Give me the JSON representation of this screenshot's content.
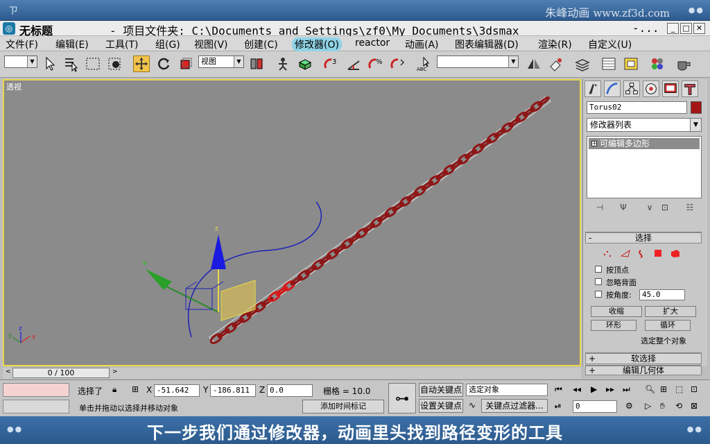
{
  "player": {
    "logo": "ㄗ",
    "watermark": "朱峰动画",
    "watermark_url": "www.zf3d.com",
    "dots_left": "●●",
    "dots_right": "●●"
  },
  "window": {
    "title": "无标题",
    "path": "- 项目文件夹: C:\\Documents and Settings\\zf0\\My Documents\\3dsmax",
    "ellipsis": "-...",
    "min": "_",
    "max": "□",
    "close": "✕"
  },
  "menu": [
    "文件(F)",
    "编辑(E)",
    "工具(T)",
    "组(G)",
    "视图(V)",
    "创建(C)",
    "修改器(O)",
    "reactor",
    "动画(A)",
    "图表编辑器(D)",
    "渲染(R)",
    "自定义(U)"
  ],
  "toolbar": {
    "view_dropdown": "视图",
    "named_selection": ""
  },
  "viewport": {
    "label": "透视",
    "axis_x": "x",
    "axis_y": "y",
    "axis_z": "z",
    "gizmo_y": "y",
    "gizmo_z": "z"
  },
  "command_panel": {
    "object_name": "Torus02",
    "object_color": "#a41616",
    "modifier_list": "修改器列表",
    "stack_item": "可编辑多边形",
    "stack_item_box": "+",
    "selection_rollout": {
      "title": "选择",
      "sign": "-",
      "by_vertex": "按顶点",
      "ignore_backfacing": "忽略背面",
      "by_angle": "按角度:",
      "angle_value": "45.0",
      "shrink": "收缩",
      "grow": "扩大",
      "ring": "环形",
      "loop": "循环",
      "whole_selected": "选定整个对象"
    },
    "soft_selection": {
      "title": "软选择",
      "sign": "+"
    },
    "edit_geometry": {
      "title": "编辑几何体",
      "sign": "+"
    }
  },
  "timeline": {
    "frame": "0 / 100",
    "left_arrow": "<",
    "right_arrow": ">"
  },
  "status": {
    "selected": "选择了",
    "x_label": "X",
    "x_value": "-51.642",
    "y_label": "Y",
    "y_value": "-186.811",
    "z_label": "Z",
    "z_value": "0.0",
    "grid": "栅格 = 10.0",
    "auto_key": "自动关键点",
    "selected_object": "选定对象",
    "set_key": "设置关键点",
    "key_filters": "关键点过滤器...",
    "hint": "单击并拖动以选择并移动对象",
    "add_time_tag": "添加时间标记",
    "frame_value": "0"
  },
  "subtitle": "下一步我们通过修改器，动画里头找到路径变形的工具"
}
